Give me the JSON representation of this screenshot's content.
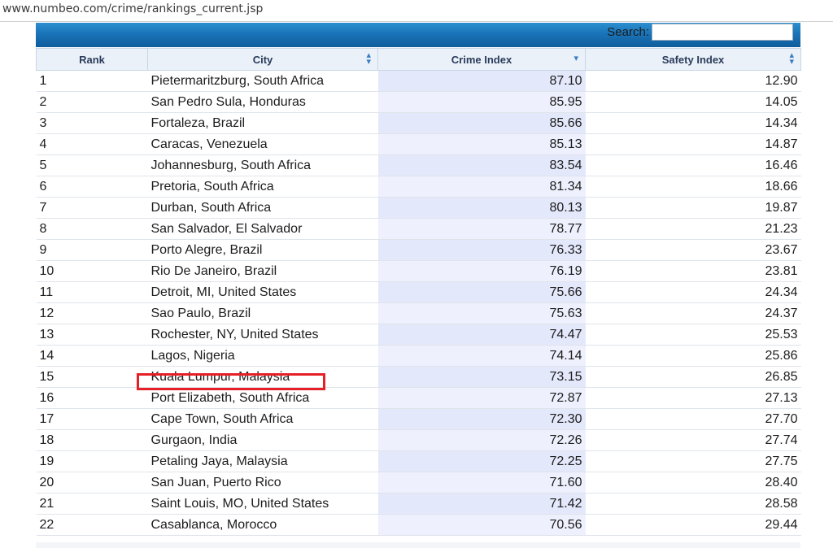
{
  "browser": {
    "url": "www.numbeo.com/crime/rankings_current.jsp"
  },
  "search": {
    "label": "Search:",
    "value": ""
  },
  "table": {
    "headers": {
      "rank": "Rank",
      "city": "City",
      "crime": "Crime Index",
      "safety": "Safety Index"
    },
    "rows": [
      {
        "rank": "1",
        "city": "Pietermaritzburg, South Africa",
        "crime": "87.10",
        "safety": "12.90"
      },
      {
        "rank": "2",
        "city": "San Pedro Sula, Honduras",
        "crime": "85.95",
        "safety": "14.05"
      },
      {
        "rank": "3",
        "city": "Fortaleza, Brazil",
        "crime": "85.66",
        "safety": "14.34"
      },
      {
        "rank": "4",
        "city": "Caracas, Venezuela",
        "crime": "85.13",
        "safety": "14.87"
      },
      {
        "rank": "5",
        "city": "Johannesburg, South Africa",
        "crime": "83.54",
        "safety": "16.46"
      },
      {
        "rank": "6",
        "city": "Pretoria, South Africa",
        "crime": "81.34",
        "safety": "18.66"
      },
      {
        "rank": "7",
        "city": "Durban, South Africa",
        "crime": "80.13",
        "safety": "19.87"
      },
      {
        "rank": "8",
        "city": "San Salvador, El Salvador",
        "crime": "78.77",
        "safety": "21.23"
      },
      {
        "rank": "9",
        "city": "Porto Alegre, Brazil",
        "crime": "76.33",
        "safety": "23.67"
      },
      {
        "rank": "10",
        "city": "Rio De Janeiro, Brazil",
        "crime": "76.19",
        "safety": "23.81"
      },
      {
        "rank": "11",
        "city": "Detroit, MI, United States",
        "crime": "75.66",
        "safety": "24.34"
      },
      {
        "rank": "12",
        "city": "Sao Paulo, Brazil",
        "crime": "75.63",
        "safety": "24.37"
      },
      {
        "rank": "13",
        "city": "Rochester, NY, United States",
        "crime": "74.47",
        "safety": "25.53"
      },
      {
        "rank": "14",
        "city": "Lagos, Nigeria",
        "crime": "74.14",
        "safety": "25.86"
      },
      {
        "rank": "15",
        "city": "Kuala Lumpur, Malaysia",
        "crime": "73.15",
        "safety": "26.85"
      },
      {
        "rank": "16",
        "city": "Port Elizabeth, South Africa",
        "crime": "72.87",
        "safety": "27.13"
      },
      {
        "rank": "17",
        "city": "Cape Town, South Africa",
        "crime": "72.30",
        "safety": "27.70"
      },
      {
        "rank": "18",
        "city": "Gurgaon, India",
        "crime": "72.26",
        "safety": "27.74"
      },
      {
        "rank": "19",
        "city": "Petaling Jaya, Malaysia",
        "crime": "72.25",
        "safety": "27.75"
      },
      {
        "rank": "20",
        "city": "San Juan, Puerto Rico",
        "crime": "71.60",
        "safety": "28.40"
      },
      {
        "rank": "21",
        "city": "Saint Louis, MO, United States",
        "crime": "71.42",
        "safety": "28.58"
      },
      {
        "rank": "22",
        "city": "Casablanca, Morocco",
        "crime": "70.56",
        "safety": "29.44"
      }
    ]
  },
  "annotation": {
    "highlight_color": "#e52026"
  },
  "colors": {
    "header_bar": "#1a73b8",
    "sort_icon": "#3a7cc4"
  },
  "icons": {
    "city_sort": "sort-both-icon",
    "crime_sort": "sort-desc-icon",
    "safety_sort": "sort-both-icon"
  }
}
